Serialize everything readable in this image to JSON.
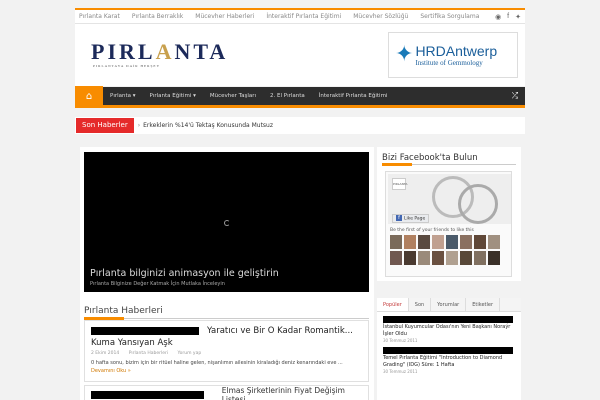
{
  "topbar": {
    "links": [
      "Pırlanta Karat",
      "Pırlanta Berraklık",
      "Mücevher Haberleri",
      "İnteraktif Pırlanta Eğitimi",
      "Mücevher Sözlüğü",
      "Sertifika Sorgulama"
    ],
    "social": [
      "rss",
      "f",
      "twitter"
    ]
  },
  "header": {
    "logo_word_a": "PIRL",
    "logo_word_b": "A",
    "logo_word_c": "NTA",
    "logo_tag": "PIRLANTAYA DAİR HERŞEY",
    "ad_main": "HRDAntwerp",
    "ad_sub": "Institute of Gemmology"
  },
  "nav": {
    "items": [
      "Pırlanta ▾",
      "Pırlanta Eğitimi ▾",
      "Mücevher Taşları",
      "2. El Pırlanta",
      "İnteraktif Pırlanta Eğitimi"
    ]
  },
  "ticker": {
    "label": "Son Haberler",
    "text": "Erkeklerin %14'ü Tektaş Konusunda Mutsuz"
  },
  "slider": {
    "title": "Pırlanta bilginizi animasyon ile geliştirin",
    "subtitle": "Pırlanta Bilginize Değer Katmak İçin Mutlaka İnceleyin"
  },
  "news": {
    "section_title": "Pırlanta Haberleri",
    "article": {
      "title_a": "Yaratıcı ve Bir O Kadar Romantik...",
      "title_b": "Kuma Yansıyan Aşk",
      "date": "2 Ekim 2014",
      "category": "Pırlanta Haberleri",
      "comments": "Yorum yap",
      "excerpt": "0 hafta sonu, bizim için bir ritüel haline gelen, nişanlımın ailesinin kiraladığı deniz kenarındaki eve ...",
      "more": "Devamını Oku »"
    },
    "article2_title": "Elmas Şirketlerinin Fiyat Değişim Listesi"
  },
  "sidebar": {
    "fb_title": "Bizi Facebook'ta Bulun",
    "fb_like": "Like Page",
    "fb_friends": "Be the first of your friends to like this",
    "fb_thumb": "PIRLANTA",
    "tabs": [
      "Popüler",
      "Son",
      "Yorumlar",
      "Etiketler"
    ],
    "popular": [
      {
        "title": "İstanbul Kuyumcular Odası'nın Yeni Başkanı Noraýr İşler Oldu",
        "date": "30 Temmuz 2011"
      },
      {
        "title": "Temel Pırlanta Eğitimi \"Introduction to Diamond Grading\" (IDG) Süre: 1 Hafta",
        "date": "30 Temmuz 2011"
      }
    ]
  },
  "colors": {
    "accent": "#f88c00",
    "nav_bg": "#2d2d2d",
    "ticker_label": "#e52a2a",
    "facebook": "#4267b2"
  }
}
